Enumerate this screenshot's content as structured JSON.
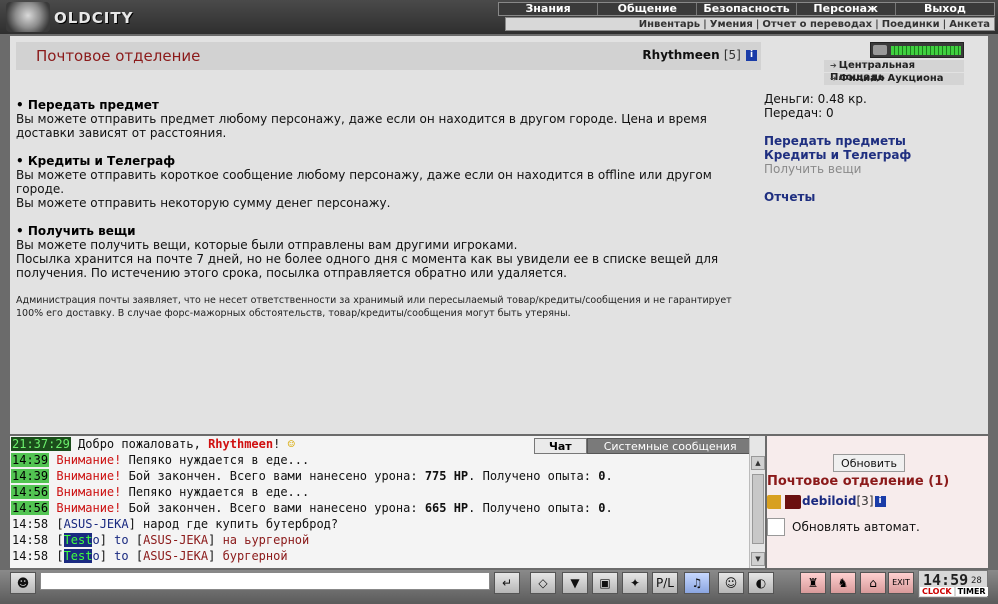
{
  "app": {
    "logo_text": "OLDCITY"
  },
  "nav_main": [
    "Знания",
    "Общение",
    "Безопасность",
    "Персонаж",
    "Выход"
  ],
  "nav_sub": [
    "Инвентарь",
    "Умения",
    "Отчет о переводах",
    "Поединки",
    "Анкета"
  ],
  "page": {
    "title": "Почтовое отделение",
    "player_name": "Rhythmeen",
    "player_level": "[5]"
  },
  "sections": [
    {
      "heading": "• Передать предмет",
      "lines": [
        "Вы можете отправить предмет любому персонажу, даже если он находится в другом городе. Цена и время доставки зависят от расстояния."
      ]
    },
    {
      "heading": "• Кредиты и Телеграф",
      "lines": [
        "Вы можете отправить короткое сообщение любому персонажу, даже если он находится в offline или другом городе.",
        "Вы можете отправить некоторую сумму денег персонажу."
      ]
    },
    {
      "heading": "• Получить вещи",
      "lines": [
        "Вы можете получить вещи, которые были отправлены вам другими игроками.",
        "Посылка хранится на почте 7 дней, но не более одного дня с момента как вы увидели ее в списке вещей для получения. По истечению этого срока, посылка отправляется обратно или удаляется."
      ]
    }
  ],
  "disclaimer": "Администрация почты заявляет, что не несет ответственности за хранимый или пересылаемый товар/кредиты/сообщения и не гарантирует 100% его доставку. В случае форс-мажорных обстоятельств, товар/кредиты/сообщения могут быть утеряны.",
  "right": {
    "locations": [
      "Центральная Площадь",
      "Филиал Аукциона"
    ],
    "money": "Деньги: 0.48 кр.",
    "transfers": "Передач: 0",
    "actions": {
      "give_items": "Передать предметы",
      "credits_telegraph": "Кредиты и Телеграф",
      "get_items": "Получить вещи",
      "reports": "Отчеты"
    }
  },
  "chat": {
    "tab_chat": "Чат",
    "tab_system": "Системные сообщения",
    "lines": [
      {
        "time": "21:37:29",
        "time_style": "dark",
        "parts": [
          [
            "lbl",
            " Добро пожаловать, "
          ],
          [
            "bold-red",
            "Rhythmeen"
          ],
          [
            "lbl",
            "! "
          ]
        ]
      },
      {
        "time": "14:39",
        "time_style": "light",
        "parts": [
          [
            "warn",
            " Внимание!"
          ],
          [
            "lbl",
            " Пепяко нуждается в еде..."
          ]
        ]
      },
      {
        "time": "14:39",
        "time_style": "light",
        "parts": [
          [
            "warn",
            " Внимание!"
          ],
          [
            "lbl",
            " Бой закончен. Всего вами нанесено урона: "
          ],
          [
            "hl",
            "775 HP"
          ],
          [
            "lbl",
            ". Получено опыта: "
          ],
          [
            "hl",
            "0"
          ],
          [
            "lbl",
            "."
          ]
        ]
      },
      {
        "time": "14:56",
        "time_style": "light",
        "parts": [
          [
            "warn",
            " Внимание!"
          ],
          [
            "lbl",
            " Пепяко нуждается в еде..."
          ]
        ]
      },
      {
        "time": "14:56",
        "time_style": "light",
        "parts": [
          [
            "warn",
            " Внимание!"
          ],
          [
            "lbl",
            " Бой закончен. Всего вами нанесено урона: "
          ],
          [
            "hl",
            "665 HP"
          ],
          [
            "lbl",
            ". Получено опыта: "
          ],
          [
            "hl",
            "0"
          ],
          [
            "lbl",
            "."
          ]
        ]
      },
      {
        "time": "14:58",
        "time_style": "none",
        "parts": [
          [
            "lbl",
            " ["
          ],
          [
            "usr",
            "ASUS-JEKA"
          ],
          [
            "lbl",
            "] народ где купить бутерброд?"
          ]
        ]
      },
      {
        "time": "14:58",
        "time_style": "none",
        "parts": [
          [
            "lbl",
            " ["
          ],
          [
            "testo-hl",
            "Test"
          ],
          [
            "usr",
            "o"
          ],
          [
            "lbl",
            "] "
          ],
          [
            "to",
            "to"
          ],
          [
            "lbl",
            " ["
          ],
          [
            "br",
            "ASUS-JEKA"
          ],
          [
            "lbl",
            "] "
          ],
          [
            "br",
            "на ьургерной"
          ]
        ]
      },
      {
        "time": "14:58",
        "time_style": "none",
        "parts": [
          [
            "lbl",
            " ["
          ],
          [
            "testo-hl",
            "Test"
          ],
          [
            "usr",
            "o"
          ],
          [
            "lbl",
            "] "
          ],
          [
            "to",
            "to"
          ],
          [
            "lbl",
            " ["
          ],
          [
            "br",
            "ASUS-JEKA"
          ],
          [
            "lbl",
            "] "
          ],
          [
            "br",
            "бургерной"
          ]
        ]
      }
    ]
  },
  "who": {
    "refresh": "Обновить",
    "room": "Почтовое отделение (1)",
    "user": "debiloid",
    "user_level": "[3]",
    "auto": "Обновлять автомат."
  },
  "toolbar": {
    "pl_label": "P/L",
    "exit_label": "EXIT"
  },
  "clock": {
    "time": "14:59",
    "seconds": "28",
    "clock_label": "CLOCK",
    "timer_label": "TIMER"
  },
  "colors": {
    "title_red": "#8b1a1a",
    "link_blue": "#1f2f80",
    "timestamp_green": "#52c452"
  }
}
